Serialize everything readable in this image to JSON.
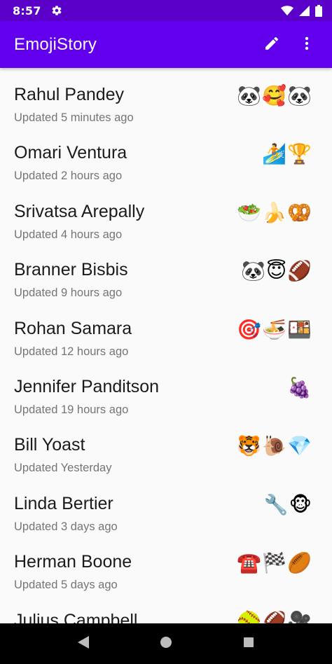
{
  "status_bar": {
    "time": "8:57",
    "icons": [
      "gear-icon",
      "wifi-icon",
      "signal-icon",
      "battery-icon"
    ]
  },
  "app_bar": {
    "title": "EmojiStory",
    "actions": [
      "edit-icon",
      "more-vert-icon"
    ],
    "color": "#6200ee"
  },
  "list": {
    "items": [
      {
        "name": "Rahul Pandey",
        "updated": "Updated 5 minutes ago",
        "emojis": "🐼🥰🐼"
      },
      {
        "name": "Omari Ventura",
        "updated": "Updated 2 hours ago",
        "emojis": "🏄🏆"
      },
      {
        "name": "Srivatsa Arepally",
        "updated": "Updated 4 hours ago",
        "emojis": "🥗🍌🥨"
      },
      {
        "name": "Branner Bisbis",
        "updated": "Updated 9 hours ago",
        "emojis": "🐼😇🏈"
      },
      {
        "name": "Rohan Samara",
        "updated": "Updated 12 hours ago",
        "emojis": "🎯🍜🍱"
      },
      {
        "name": "Jennifer Panditson",
        "updated": "Updated 19 hours ago",
        "emojis": "🍇"
      },
      {
        "name": "Bill Yoast",
        "updated": "Updated Yesterday",
        "emojis": "🐯🐌💎"
      },
      {
        "name": "Linda Bertier",
        "updated": "Updated 3 days ago",
        "emojis": "🔧🐵"
      },
      {
        "name": "Herman Boone",
        "updated": "Updated 5 days ago",
        "emojis": "☎️🏁🏉"
      },
      {
        "name": "Julius Campbell",
        "updated": "",
        "emojis": "🥎🏈🎥"
      }
    ]
  },
  "nav_bar": {
    "buttons": [
      "back-icon",
      "home-icon",
      "recents-icon"
    ]
  }
}
